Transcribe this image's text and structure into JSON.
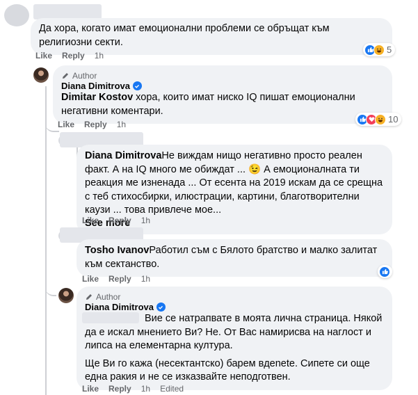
{
  "comments": [
    {
      "id": "c1",
      "text": "Да хора, когато имат емоционални проблеми се обръщат към религиозни секти.",
      "actions": {
        "like": "Like",
        "reply": "Reply",
        "time": "1h"
      },
      "reactions": {
        "count": "5",
        "icons": [
          "like-icon",
          "haha-icon"
        ]
      }
    },
    {
      "id": "c2",
      "author_badge": "Author",
      "name": "Diana Dimitrova",
      "mention": "Dimitar Kostov",
      "text": " хора, които имат ниско IQ пишат емоционални негативни коментари.",
      "actions": {
        "like": "Like",
        "reply": "Reply",
        "time": "1h"
      },
      "reactions": {
        "count": "10",
        "icons": [
          "like-icon",
          "love-icon",
          "haha-icon"
        ]
      }
    },
    {
      "id": "c3",
      "mention": "Diana Dimitrova",
      "text": "Не виждам нищо негативно просто реален факт. А на IQ много ме обиждат ... 😉 А емоционалната ти реакция ме изненада ... От есента на 2019 искам да се срещна с теб стихосбирки, илюстрации, картини, благотворителни каузи ... това привлече мое...",
      "see_more": "See more",
      "actions": {
        "like": "Like",
        "reply": "Reply",
        "time": "1h"
      }
    },
    {
      "id": "c4",
      "mention": "Tosho Ivanov",
      "text": "Работил съм с Бялото братство и малко залитат към сектанство.",
      "actions": {
        "like": "Like",
        "reply": "Reply",
        "time": "1h"
      },
      "reactions": {
        "count": "",
        "icons": [
          "like-icon"
        ]
      }
    },
    {
      "id": "c5",
      "author_badge": "Author",
      "name": "Diana Dimitrova",
      "text": "Вие се натрапвате в моята лична страница. Някой да е искал мнението Ви? Не. От Вас намирисва на наглост и липса на елементарна култура.",
      "text2": "Ще Ви го кажа (несектантско) барем вдenete. Сипете си още една ракия и не се изказвайте неподготвен.",
      "actions": {
        "like": "Like",
        "reply": "Reply",
        "time": "1h",
        "edited": "Edited"
      }
    }
  ]
}
